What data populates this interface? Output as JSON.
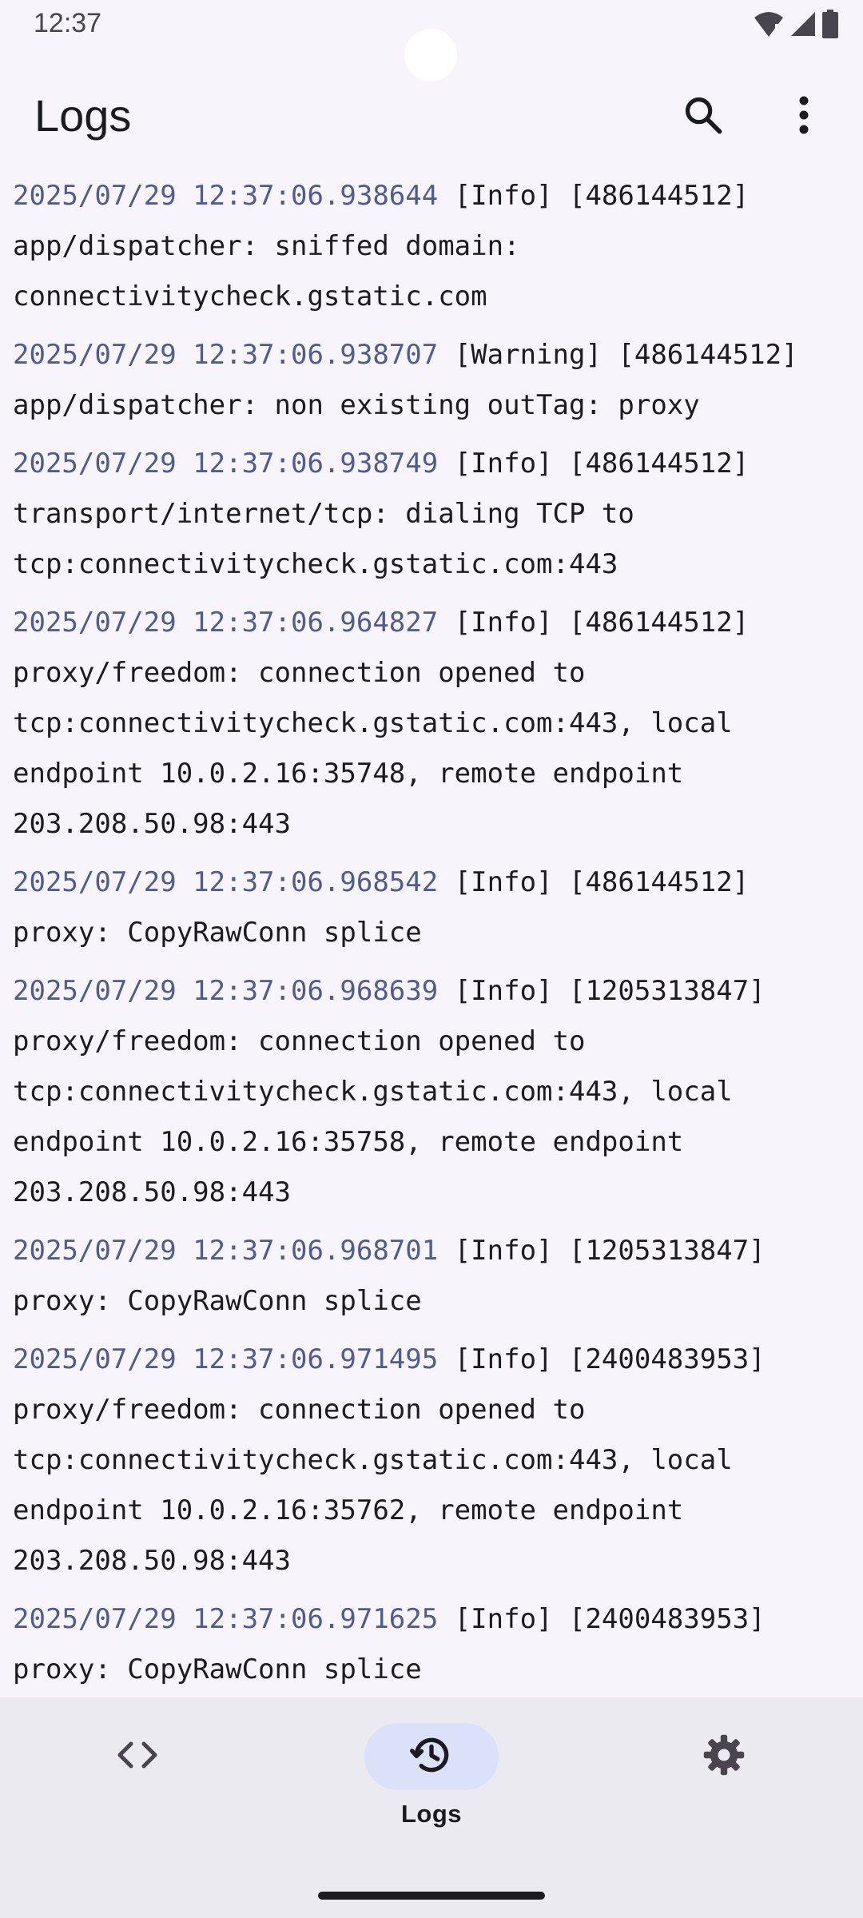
{
  "status_bar": {
    "time": "12:37",
    "icons": [
      "wifi-icon",
      "signal-icon",
      "battery-icon"
    ]
  },
  "app_bar": {
    "title": "Logs",
    "actions": [
      "search-icon",
      "more-vert-icon"
    ]
  },
  "logs": [
    {
      "timestamp": "2025/07/29 12:37:06.938644",
      "text": "[Info] [486144512] app/dispatcher: sniffed domain: connectivitycheck.gstatic.com"
    },
    {
      "timestamp": "2025/07/29 12:37:06.938707",
      "text": "[Warning] [486144512] app/dispatcher: non existing outTag: proxy"
    },
    {
      "timestamp": "2025/07/29 12:37:06.938749",
      "text": "[Info] [486144512] transport/internet/tcp: dialing TCP to tcp:connectivitycheck.gstatic.com:443"
    },
    {
      "timestamp": "2025/07/29 12:37:06.964827",
      "text": "[Info] [486144512] proxy/freedom: connection opened to tcp:connectivitycheck.gstatic.com:443, local endpoint 10.0.2.16:35748, remote endpoint 203.208.50.98:443"
    },
    {
      "timestamp": "2025/07/29 12:37:06.968542",
      "text": "[Info] [486144512] proxy: CopyRawConn splice"
    },
    {
      "timestamp": "2025/07/29 12:37:06.968639",
      "text": "[Info] [1205313847] proxy/freedom: connection opened to tcp:connectivitycheck.gstatic.com:443, local endpoint 10.0.2.16:35758, remote endpoint 203.208.50.98:443"
    },
    {
      "timestamp": "2025/07/29 12:37:06.968701",
      "text": "[Info] [1205313847] proxy: CopyRawConn splice"
    },
    {
      "timestamp": "2025/07/29 12:37:06.971495",
      "text": "[Info] [2400483953] proxy/freedom: connection opened to tcp:connectivitycheck.gstatic.com:443, local endpoint 10.0.2.16:35762, remote endpoint 203.208.50.98:443"
    },
    {
      "timestamp": "2025/07/29 12:37:06.971625",
      "text": "[Info] [2400483953] proxy: CopyRawConn splice"
    }
  ],
  "bottom_nav": {
    "items": [
      {
        "icon": "code-icon",
        "label": "",
        "active": false
      },
      {
        "icon": "history-icon",
        "label": "Logs",
        "active": true
      },
      {
        "icon": "settings-gear-icon",
        "label": "",
        "active": false
      }
    ]
  },
  "colors": {
    "background": "#f7f5fb",
    "timestamp": "#4f5b92",
    "nav_background": "#ebeaf1",
    "nav_active_indicator": "#dbe1f9",
    "text": "#1c1b1f"
  }
}
